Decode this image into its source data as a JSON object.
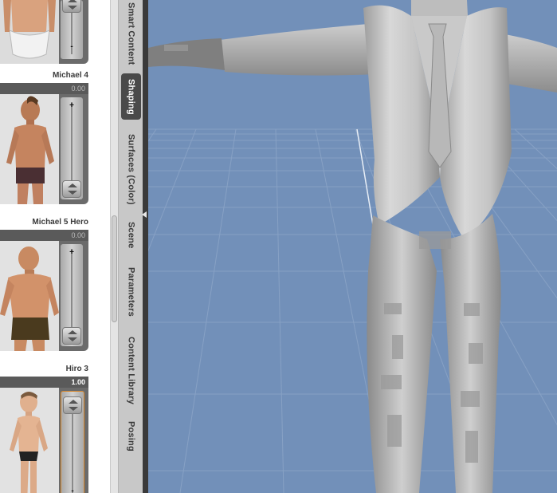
{
  "shaping_panel": {
    "cards": [
      {
        "name": "",
        "value": "",
        "state": "partial-top"
      },
      {
        "name": "Michael 4",
        "value": "0.00",
        "state": "inactive"
      },
      {
        "name": "Michael 5 Hero",
        "value": "0.00",
        "state": "inactive"
      },
      {
        "name": "Hiro 3",
        "value": "1.00",
        "state": "active"
      }
    ],
    "slider_plus": "+",
    "slider_minus": "-"
  },
  "tabs": [
    {
      "label": "Smart Content",
      "active": false
    },
    {
      "label": "Shaping",
      "active": true
    },
    {
      "label": "Surfaces (Color)",
      "active": false
    },
    {
      "label": "Scene",
      "active": false
    },
    {
      "label": "Parameters",
      "active": false
    },
    {
      "label": "Content Library",
      "active": false
    },
    {
      "label": "Posing",
      "active": false
    }
  ],
  "colors": {
    "viewport_bg": "#7290b9",
    "grid_line": "#8aa3c6",
    "figure_gray": "#c2c2c2",
    "active_slider_border": "#d6872e"
  },
  "viewport": {
    "subject": "figure-in-vest-and-tie",
    "mode": "3d-perspective-grid"
  }
}
